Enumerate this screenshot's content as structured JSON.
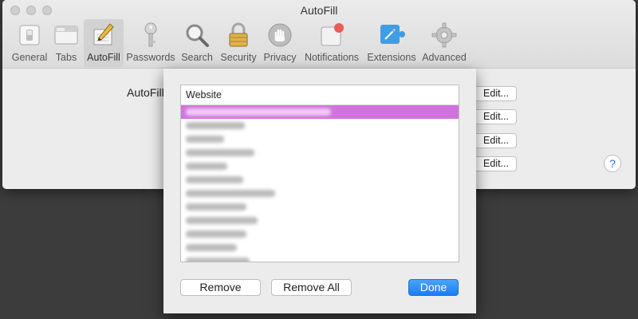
{
  "window": {
    "title": "AutoFill"
  },
  "toolbar": {
    "items": [
      {
        "label": "General",
        "icon": "general-switch-icon"
      },
      {
        "label": "Tabs",
        "icon": "tabs-icon"
      },
      {
        "label": "AutoFill",
        "icon": "pencil-icon",
        "selected": true
      },
      {
        "label": "Passwords",
        "icon": "key-icon"
      },
      {
        "label": "Search",
        "icon": "magnifier-icon"
      },
      {
        "label": "Security",
        "icon": "padlock-icon"
      },
      {
        "label": "Privacy",
        "icon": "hand-icon"
      },
      {
        "label": "Notifications",
        "icon": "notifications-icon"
      },
      {
        "label": "Extensions",
        "icon": "puzzle-icon"
      },
      {
        "label": "Advanced",
        "icon": "gear-icon"
      }
    ]
  },
  "content": {
    "autofill_label": "AutoFill",
    "edit_labels": [
      "Edit...",
      "Edit...",
      "Edit...",
      "Edit..."
    ],
    "help_label": "?"
  },
  "sheet": {
    "column_header": "Website",
    "remove_label": "Remove",
    "remove_all_label": "Remove All",
    "done_label": "Done"
  },
  "colors": {
    "selection": "#d173dc",
    "accent": "#1b7ef7",
    "background": "#3c3c3c"
  }
}
